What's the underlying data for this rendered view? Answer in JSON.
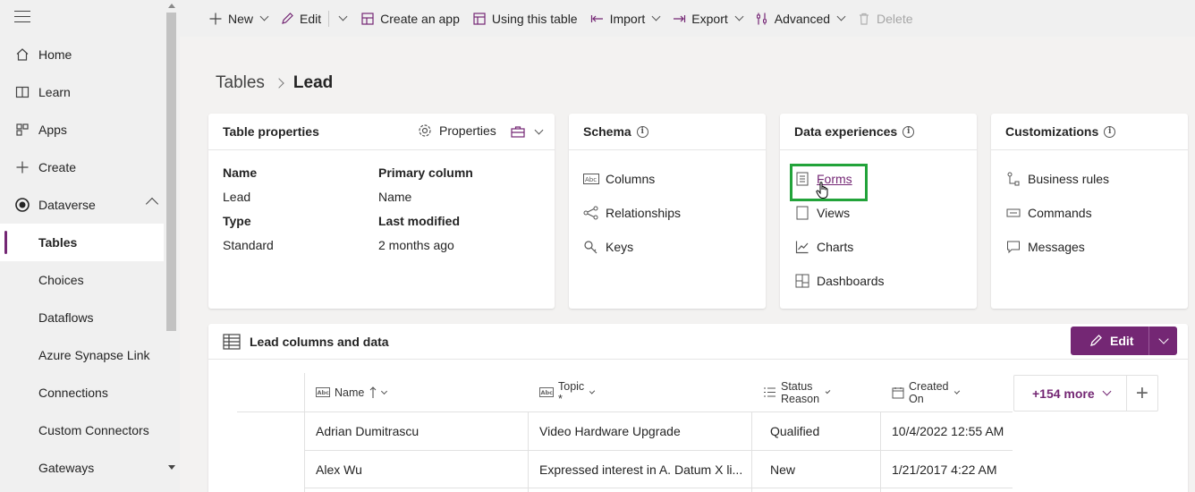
{
  "sidebar": {
    "items": [
      {
        "label": "Home",
        "icon": "home-icon"
      },
      {
        "label": "Learn",
        "icon": "book-icon"
      },
      {
        "label": "Apps",
        "icon": "apps-icon"
      },
      {
        "label": "Create",
        "icon": "plus-icon"
      },
      {
        "label": "Dataverse",
        "icon": "dataverse-icon"
      }
    ],
    "subitems": [
      {
        "label": "Tables",
        "active": true
      },
      {
        "label": "Choices"
      },
      {
        "label": "Dataflows"
      },
      {
        "label": "Azure Synapse Link"
      },
      {
        "label": "Connections"
      },
      {
        "label": "Custom Connectors"
      },
      {
        "label": "Gateways"
      }
    ]
  },
  "commandbar": {
    "new": "New",
    "edit": "Edit",
    "create_app": "Create an app",
    "using_table": "Using this table",
    "import": "Import",
    "export": "Export",
    "advanced": "Advanced",
    "delete": "Delete"
  },
  "breadcrumb": {
    "parent": "Tables",
    "current": "Lead"
  },
  "table_properties": {
    "title": "Table properties",
    "properties_label": "Properties",
    "name_label": "Name",
    "name_value": "Lead",
    "type_label": "Type",
    "type_value": "Standard",
    "primary_label": "Primary column",
    "primary_value": "Name",
    "modified_label": "Last modified",
    "modified_value": "2 months ago"
  },
  "schema": {
    "title": "Schema",
    "items": [
      "Columns",
      "Relationships",
      "Keys"
    ]
  },
  "data_experiences": {
    "title": "Data experiences",
    "items": [
      "Forms",
      "Views",
      "Charts",
      "Dashboards"
    ]
  },
  "customizations": {
    "title": "Customizations",
    "items": [
      "Business rules",
      "Commands",
      "Messages"
    ]
  },
  "columns_panel": {
    "title": "Lead columns and data",
    "edit_label": "Edit",
    "headers": [
      "Name",
      "Topic *",
      "Status Reason",
      "Created On"
    ],
    "more_label": "+154 more",
    "rows": [
      [
        "Adrian Dumitrascu",
        "Video Hardware Upgrade",
        "Qualified",
        "10/4/2022 12:55 AM"
      ],
      [
        "Alex Wu",
        "Expressed interest in A. Datum X li...",
        "New",
        "1/21/2017 4:22 AM"
      ]
    ]
  },
  "colors": {
    "accent": "#742774",
    "highlight": "#22a33a"
  }
}
